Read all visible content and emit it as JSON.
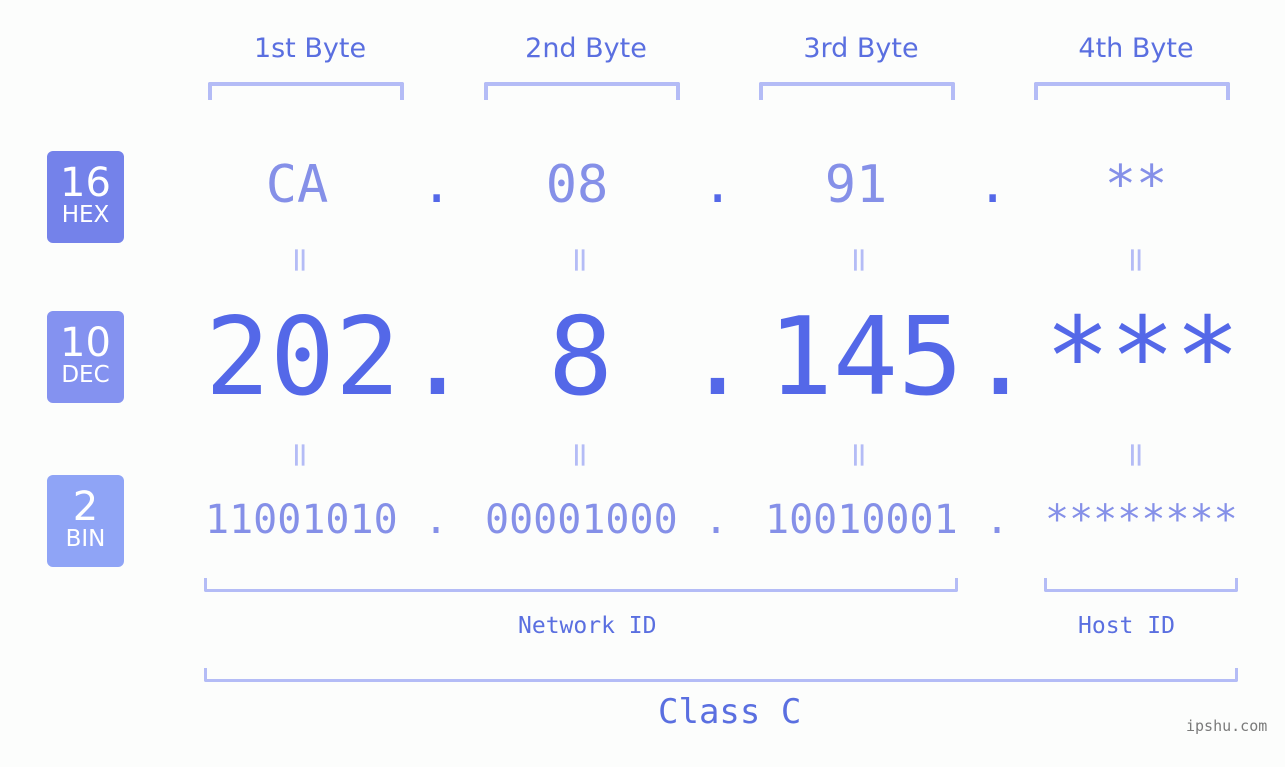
{
  "bytes": [
    {
      "label": "1st Byte",
      "hex": "CA",
      "dec": "202",
      "bin": "11001010"
    },
    {
      "label": "2nd Byte",
      "hex": "08",
      "dec": "8",
      "bin": "00001000"
    },
    {
      "label": "3rd Byte",
      "hex": "91",
      "dec": "145",
      "bin": "10010001"
    },
    {
      "label": "4th Byte",
      "hex": "**",
      "dec": "***",
      "bin": "********"
    }
  ],
  "badges": {
    "hex": {
      "num": "16",
      "label": "HEX",
      "color": "#7482ea"
    },
    "dec": {
      "num": "10",
      "label": "DEC",
      "color": "#8492f0"
    },
    "bin": {
      "num": "2",
      "label": "BIN",
      "color": "#8fa4f6"
    }
  },
  "separator": ".",
  "equals": "=",
  "network_id_label": "Network ID",
  "host_id_label": "Host ID",
  "class_label": "Class C",
  "watermark": "ipshu.com"
}
